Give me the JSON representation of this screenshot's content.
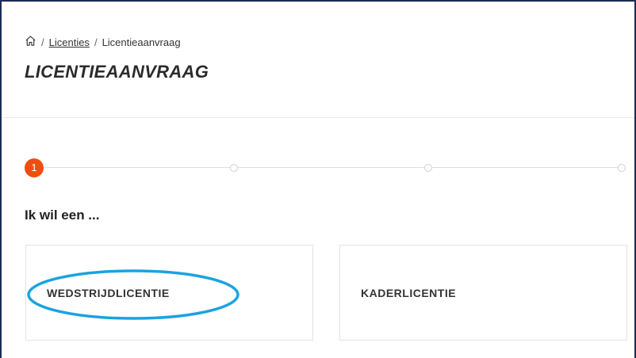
{
  "breadcrumb": {
    "home_icon": "home-icon",
    "separator": "/",
    "items": [
      "Licenties",
      "Licentieaanvraag"
    ]
  },
  "page": {
    "title": "LICENTIEAANVRAAG"
  },
  "stepper": {
    "active_step": "1",
    "total_steps": 4,
    "accent_color": "#f04e10"
  },
  "form": {
    "question": "Ik wil een ...",
    "options": [
      {
        "label": "WEDSTRIJDLICENTIE",
        "highlighted": true
      },
      {
        "label": "KADERLICENTIE",
        "highlighted": false
      }
    ]
  },
  "colors": {
    "frame_border": "#1e2a5a",
    "highlight": "#1aa3e0"
  }
}
